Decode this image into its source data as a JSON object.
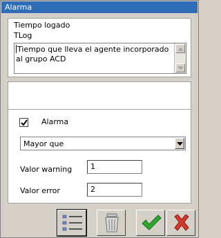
{
  "window": {
    "title": "Alarma"
  },
  "info": {
    "title": "Tiempo logado",
    "name": "TLog",
    "description": "Tiempo que lleva el agente incorporado al grupo ACD"
  },
  "alarm": {
    "enabled": true,
    "label": "Alarma",
    "condition": {
      "selected": "Mayor que"
    },
    "warning": {
      "label": "Valor warning",
      "value": "1"
    },
    "error": {
      "label": "Valor error",
      "value": "2"
    }
  },
  "toolbar": {
    "buttons": [
      {
        "icon": "list-icon"
      },
      {
        "icon": "trash-icon"
      },
      {
        "icon": "check-icon"
      },
      {
        "icon": "close-icon"
      }
    ]
  },
  "colors": {
    "titlebar": "#2f6db6",
    "accept": "#2fa82f",
    "cancel": "#d23a2a"
  }
}
